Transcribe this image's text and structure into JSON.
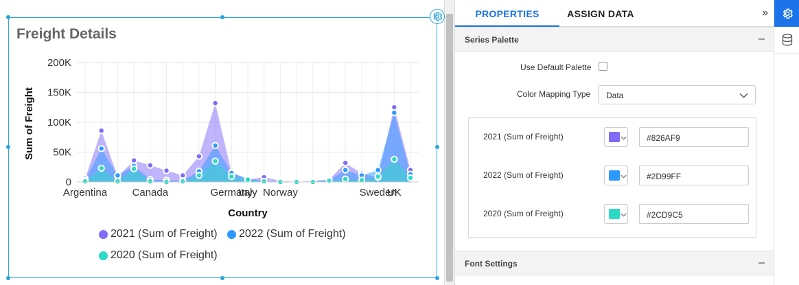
{
  "widget": {
    "title": "Freight Details"
  },
  "chart_data": {
    "type": "area",
    "title": "Freight Details",
    "xlabel": "Country",
    "ylabel": "Sum of Freight",
    "ylim": [
      0,
      200000
    ],
    "yticks": [
      {
        "value": 0,
        "label": "0"
      },
      {
        "value": 50000,
        "label": "50K"
      },
      {
        "value": 100000,
        "label": "100K"
      },
      {
        "value": 150000,
        "label": "150K"
      },
      {
        "value": 200000,
        "label": "200K"
      }
    ],
    "tick_labels": [
      {
        "index": 0,
        "label": "Argentina"
      },
      {
        "index": 4,
        "label": "Canada"
      },
      {
        "index": 9,
        "label": "Germany"
      },
      {
        "index": 10,
        "label": "Italy"
      },
      {
        "index": 12,
        "label": "Norway"
      },
      {
        "index": 18,
        "label": "Sweden"
      },
      {
        "index": 19,
        "label": "UK"
      }
    ],
    "point_count": 21,
    "grid": true,
    "legend_position": "bottom",
    "series": [
      {
        "name": "2021 (Sum of Freight)",
        "color": "#826AF9",
        "values": [
          6000,
          86000,
          9000,
          36000,
          28000,
          19000,
          11000,
          43000,
          132000,
          16000,
          4000,
          8000,
          2000,
          0,
          2000,
          4000,
          32000,
          14000,
          8000,
          125000,
          20000
        ]
      },
      {
        "name": "2022 (Sum of Freight)",
        "color": "#2D99FF",
        "values": [
          3000,
          56000,
          11000,
          27000,
          4000,
          3000,
          2000,
          18000,
          61000,
          15000,
          6000,
          1000,
          0,
          0,
          1000,
          3000,
          20000,
          11000,
          20000,
          116000,
          13000
        ]
      },
      {
        "name": "2020 (Sum of Freight)",
        "color": "#2CD9C5",
        "values": [
          1000,
          23000,
          1000,
          22000,
          1000,
          0,
          1000,
          11000,
          35000,
          9000,
          4000,
          1000,
          0,
          0,
          0,
          2000,
          5000,
          3000,
          9000,
          38000,
          7000
        ]
      }
    ]
  },
  "panel": {
    "tabs": [
      "PROPERTIES",
      "ASSIGN DATA"
    ],
    "collapse_glyph": "»",
    "series_palette": {
      "title": "Series Palette",
      "toggle": "–",
      "use_default_label": "Use Default Palette",
      "color_mapping_label": "Color Mapping Type",
      "color_mapping_value": "Data",
      "items": [
        {
          "label": "2021 (Sum of Freight)",
          "color": "#826AF9",
          "hex": "#826AF9"
        },
        {
          "label": "2022 (Sum of Freight)",
          "color": "#2D99FF",
          "hex": "#2D99FF"
        },
        {
          "label": "2020 (Sum of Freight)",
          "color": "#2CD9C5",
          "hex": "#2CD9C5"
        }
      ]
    },
    "font_settings": {
      "title": "Font Settings",
      "toggle": "–"
    }
  },
  "icons": {
    "widget_settings": "gear-icon",
    "rail_settings": "gear-icon",
    "rail_data": "database-icon"
  }
}
